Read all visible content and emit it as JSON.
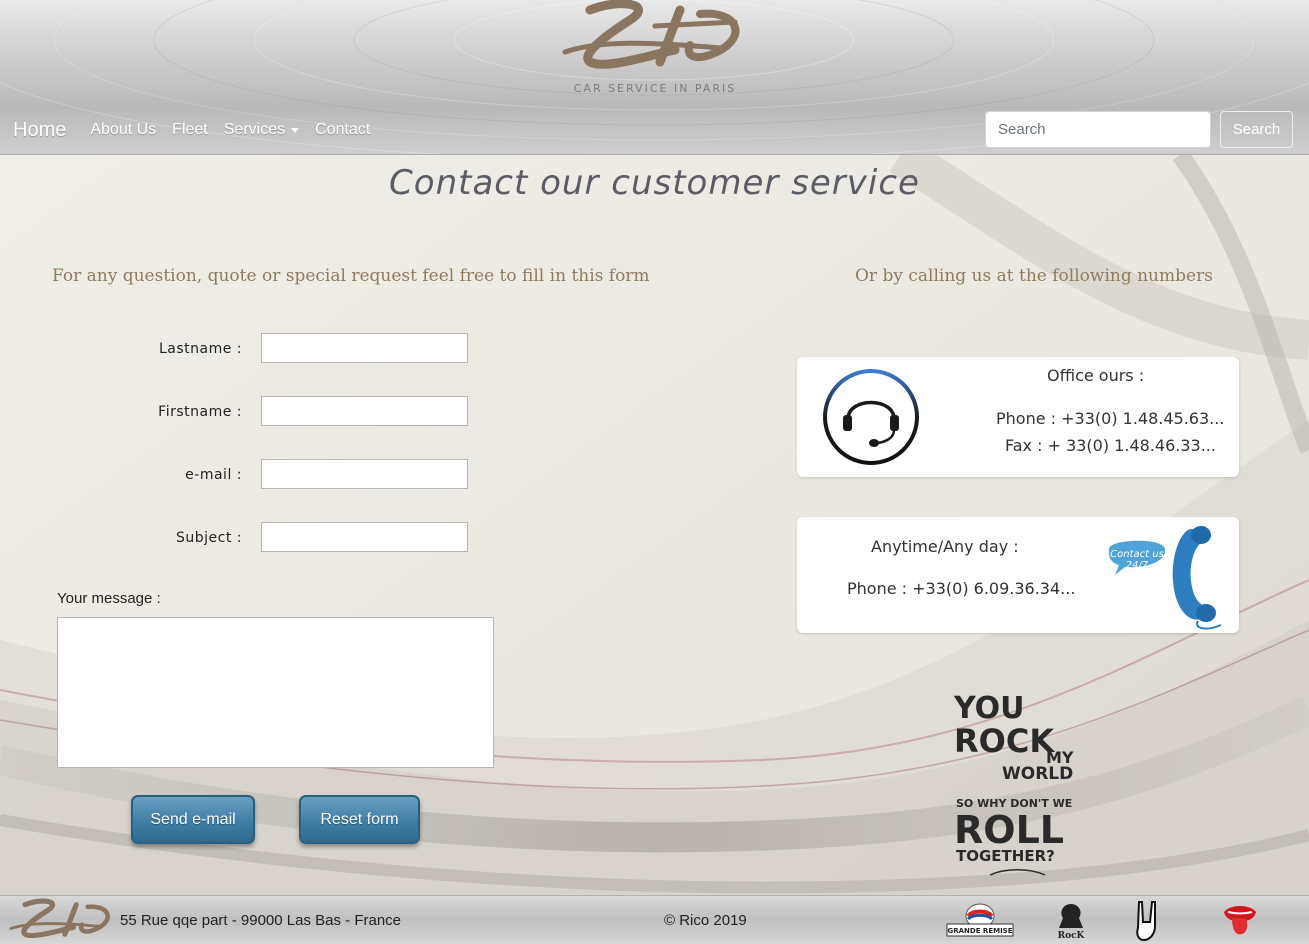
{
  "header": {
    "logo_text": "LTD",
    "tagline": "CAR SERVICE IN PARIS"
  },
  "nav": {
    "brand": "Home",
    "items": [
      {
        "label": "About Us"
      },
      {
        "label": "Fleet"
      },
      {
        "label": "Services"
      },
      {
        "label": "Contact"
      }
    ],
    "search": {
      "placeholder": "Search",
      "button_label": "Search"
    }
  },
  "main": {
    "title": "Contact our customer service",
    "form_intro": "For any question, quote or special request feel free to fill in this form",
    "phone_intro": "Or by calling us at the following numbers",
    "form": {
      "lastname_label": "Lastname :",
      "firstname_label": "Firstname :",
      "email_label": "e-mail :",
      "subject_label": "Subject :",
      "message_label": "Your message :",
      "send_label": "Send e-mail",
      "reset_label": "Reset  form"
    },
    "office_card": {
      "heading": "Office ours :",
      "phone": "Phone : +33(0) 1.48.45.63...",
      "fax": "Fax : + 33(0) 1.48.46.33..."
    },
    "anytime_card": {
      "heading": "Anytime/Any day :",
      "phone": "Phone : +33(0) 6.09.36.34...",
      "bubble_line1": "Contact us",
      "bubble_line2": "24/7"
    },
    "rock_badge": {
      "line1": "YOU",
      "line2": "ROCK",
      "line3": "MY",
      "line4": "WORLD",
      "line5": "SO WHY DON'T WE",
      "line6": "ROLL",
      "line7": "TOGETHER?"
    }
  },
  "footer": {
    "address": "55 Rue qqe part - 99000 Las Bas - France",
    "copyright": "© Rico 2019",
    "badge_grande_remise": "GRANDE REMISE",
    "badge_rock": "RocK"
  },
  "colors": {
    "title": "#5d5c66",
    "intro_text": "#8f7c5c",
    "button": "#3f7ea6",
    "logo": "#8a7560"
  }
}
